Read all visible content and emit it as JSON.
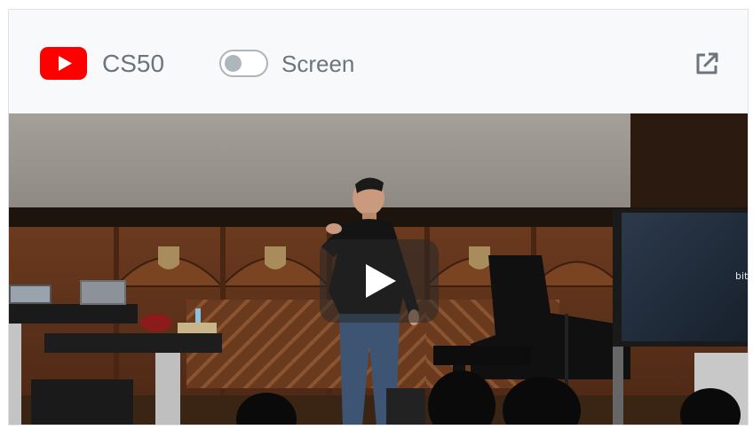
{
  "header": {
    "logo_icon": "youtube-logo-icon",
    "channel_name": "CS50",
    "toggle": {
      "label": "Screen",
      "on": false
    },
    "external_link_icon": "external-link-icon"
  },
  "video": {
    "play_icon": "play-icon",
    "screen_text": "bit"
  },
  "colors": {
    "youtube_red": "#ff0000",
    "muted_text": "#6c757d",
    "toggle_border": "#adb5bd",
    "header_bg": "#f8f9fa"
  }
}
